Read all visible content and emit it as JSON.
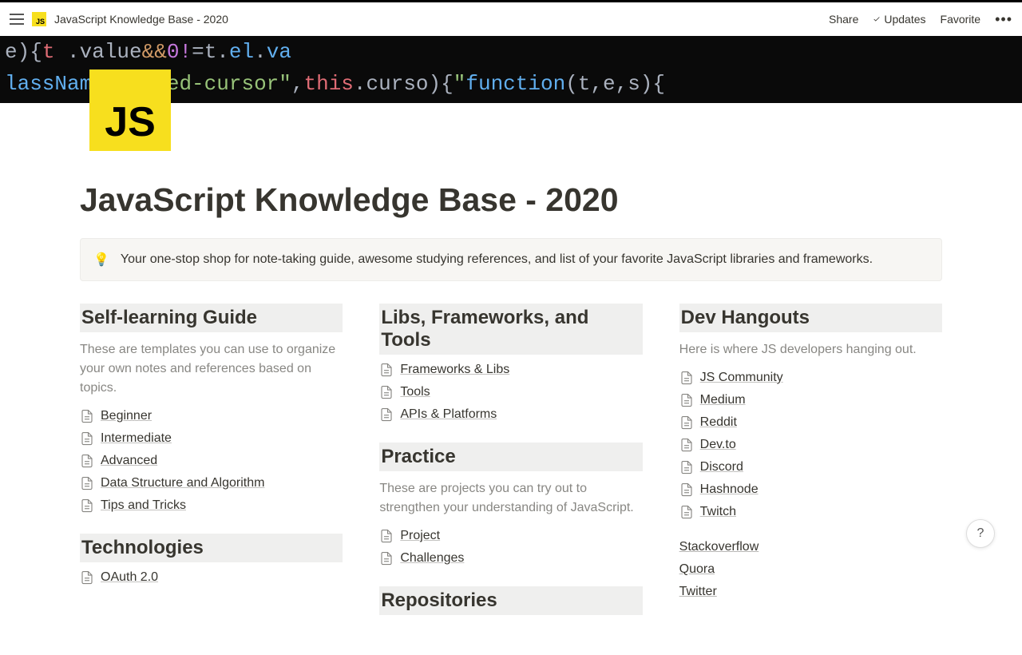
{
  "topbar": {
    "breadcrumb": "JavaScript Knowledge Base - 2020",
    "share": "Share",
    "updates": "Updates",
    "favorite": "Favorite"
  },
  "page": {
    "icon_text": "JS",
    "title": "JavaScript Knowledge Base - 2020",
    "callout_icon": "💡",
    "callout_text": "Your one-stop shop for note-taking guide, awesome studying references, and list of your favorite JavaScript libraries and frameworks."
  },
  "columns": [
    {
      "sections": [
        {
          "heading": "Self-learning Guide",
          "desc": "These are templates you can use to organize your own notes and references based on topics.",
          "pages": [
            "Beginner",
            "Intermediate",
            "Advanced",
            "Data Structure and Algorithm",
            "Tips and Tricks"
          ]
        },
        {
          "heading": "Technologies",
          "pages": [
            "OAuth 2.0"
          ]
        }
      ]
    },
    {
      "sections": [
        {
          "heading": "Libs, Frameworks, and Tools",
          "pages": [
            "Frameworks & Libs",
            "Tools",
            "APIs & Platforms"
          ]
        },
        {
          "heading": "Practice",
          "desc": "These are projects you can try out to strengthen your understanding of JavaScript.",
          "pages": [
            "Project",
            "Challenges"
          ]
        },
        {
          "heading": "Repositories",
          "pages": []
        }
      ]
    },
    {
      "sections": [
        {
          "heading": "Dev Hangouts",
          "desc": "Here is where JS developers hanging out.",
          "pages": [
            "JS Community",
            "Medium",
            "Reddit",
            "Dev.to",
            "Discord",
            "Hashnode",
            "Twitch"
          ],
          "links": [
            "Stackoverflow",
            "Quora",
            "Twitter"
          ]
        }
      ]
    }
  ],
  "help": "?"
}
